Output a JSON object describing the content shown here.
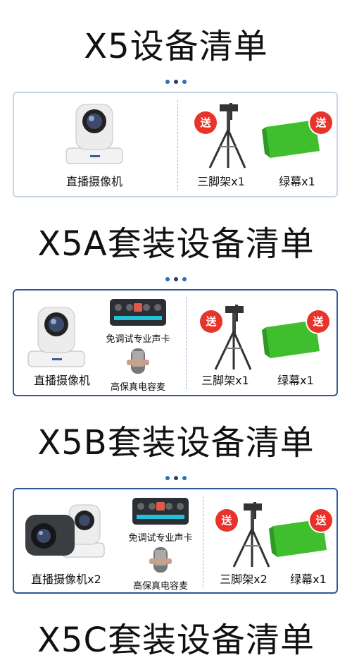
{
  "sections": [
    {
      "title": "X5设备清单",
      "items": {
        "camera": "直播摄像机",
        "tripod": "三脚架x1",
        "screen": "绿幕x1",
        "badge": "送"
      }
    },
    {
      "title": "X5A套装设备清单",
      "items": {
        "camera": "直播摄像机",
        "soundcard": "免调试专业声卡",
        "mic": "高保真电容麦",
        "tripod": "三脚架x1",
        "screen": "绿幕x1",
        "badge": "送"
      }
    },
    {
      "title": "X5B套装设备清单",
      "items": {
        "camera": "直播摄像机x2",
        "soundcard": "免调试专业声卡",
        "mic": "高保真电容麦",
        "tripod": "三脚架x2",
        "screen": "绿幕x1",
        "badge": "送"
      }
    },
    {
      "title": "X5C套装设备清单"
    }
  ],
  "colors": {
    "frame": "#2c5a96",
    "badge": "#e8332b",
    "greenscreen": "#3fbf2e"
  }
}
